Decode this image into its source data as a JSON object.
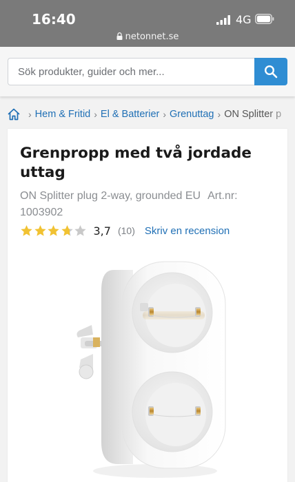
{
  "status_bar": {
    "time": "16:40",
    "network": "4G",
    "url": "netonnet.se",
    "icons": [
      "signal-icon",
      "battery-icon",
      "lock-icon"
    ]
  },
  "search": {
    "placeholder": "Sök produkter, guider och mer...",
    "value": "",
    "button_icon": "search-icon"
  },
  "breadcrumb": {
    "items": [
      "Hem & Fritid",
      "El & Batterier",
      "Grenuttag"
    ],
    "current": "ON Splitter p"
  },
  "product": {
    "title": "Grenpropp med två jordade uttag",
    "subtitle": "ON Splitter plug 2-way, grounded EU",
    "article_number": "Art.nr: 1003902",
    "rating": {
      "value": "3,7",
      "stars_filled": 3.7,
      "stars_total": 5,
      "count": "(10)",
      "review_link": "Skriv en recension"
    },
    "image_icon": "power-splitter-plug"
  },
  "colors": {
    "accent": "#2f8dd3",
    "link": "#1f6fb5",
    "star": "#f1c232",
    "status_bar": "#7a7a7a"
  }
}
